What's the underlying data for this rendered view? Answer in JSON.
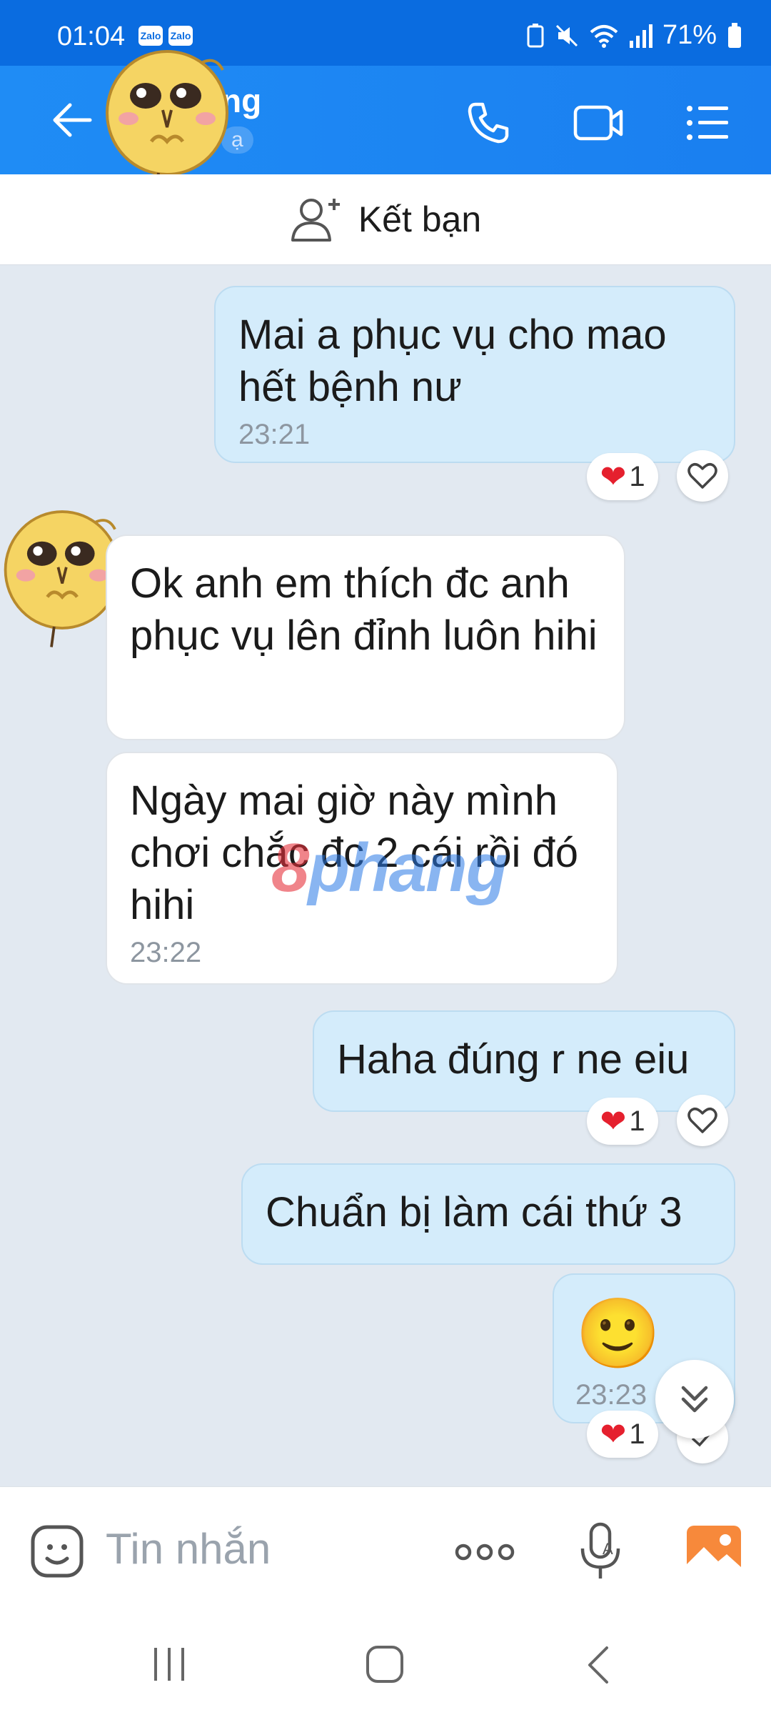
{
  "status": {
    "time": "01:04",
    "app_icons": [
      "Zalo",
      "Zalo"
    ],
    "battery": "71%"
  },
  "header": {
    "title": "ng",
    "subtitle": "ạ",
    "back_icon": "arrow-left-icon",
    "call_icon": "phone-icon",
    "video_icon": "video-camera-icon",
    "menu_icon": "list-menu-icon"
  },
  "add_friend": {
    "label": "Kết bạn",
    "icon": "add-user-icon"
  },
  "messages": [
    {
      "from": "me",
      "text": "Mai a phục vụ cho mao hết bệnh nư",
      "time": "23:21",
      "reaction": "❤",
      "reaction_count": "1"
    },
    {
      "from": "them",
      "text": "Ok anh em thích đc anh phục vụ lên đỉnh luôn hihi"
    },
    {
      "from": "them",
      "text": "Ngày mai giờ này mình chơi chắc đc 2 cái rồi đó hihi",
      "time": "23:22"
    },
    {
      "from": "me",
      "text": "Haha đúng r ne eiu",
      "reaction": "❤",
      "reaction_count": "1"
    },
    {
      "from": "me",
      "text": "Chuẩn bị làm cái thứ 3"
    },
    {
      "from": "me",
      "text": "🙂",
      "time": "23:23",
      "reaction": "❤",
      "reaction_count": "1"
    }
  ],
  "watermark": {
    "part1": "8",
    "part2": "phang"
  },
  "input": {
    "placeholder": "Tin nhắn",
    "more": "ooo"
  },
  "colors": {
    "header": "#1f8cf5",
    "mine_bubble": "#d4ecfb",
    "theirs_bubble": "#ffffff",
    "background": "#e2e9f1",
    "heart": "#e5202e"
  }
}
